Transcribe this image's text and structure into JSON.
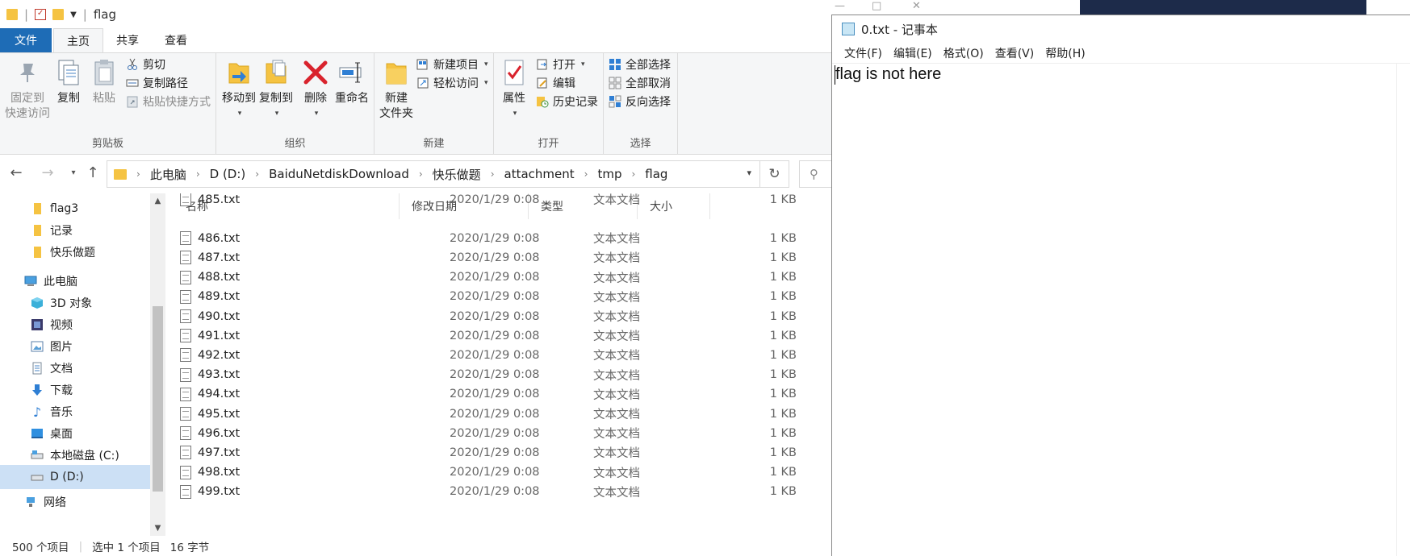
{
  "explorer": {
    "title": "flag",
    "tabs": [
      "文件",
      "主页",
      "共享",
      "查看"
    ],
    "ribbon": {
      "clipboard": {
        "label": "剪贴板",
        "pin": [
          "固定到",
          "快速访问"
        ],
        "copy": "复制",
        "paste": "粘贴",
        "cut": "剪切",
        "copy_path": "复制路径",
        "paste_shortcut": "粘贴快捷方式"
      },
      "organize": {
        "label": "组织",
        "move_to": "移动到",
        "copy_to": "复制到",
        "delete": "删除",
        "rename": "重命名"
      },
      "new": {
        "label": "新建",
        "new_folder": [
          "新建",
          "文件夹"
        ],
        "new_item": "新建项目",
        "easy_access": "轻松访问"
      },
      "open": {
        "label": "打开",
        "properties": "属性",
        "open": "打开",
        "edit": "编辑",
        "history": "历史记录"
      },
      "select": {
        "label": "选择",
        "select_all": "全部选择",
        "select_none": "全部取消",
        "invert": "反向选择"
      }
    },
    "breadcrumb": [
      "此电脑",
      "D (D:)",
      "BaiduNetdiskDownload",
      "快乐做题",
      "attachment",
      "tmp",
      "flag"
    ],
    "nav": [
      {
        "label": "flag3",
        "icon": "folder-icon"
      },
      {
        "label": "记录",
        "icon": "folder-icon"
      },
      {
        "label": "快乐做题",
        "icon": "folder-icon"
      },
      {
        "label": "此电脑",
        "icon": "computer-icon"
      },
      {
        "label": "3D 对象",
        "icon": "3d-objects-icon"
      },
      {
        "label": "视频",
        "icon": "video-icon"
      },
      {
        "label": "图片",
        "icon": "pictures-icon"
      },
      {
        "label": "文档",
        "icon": "documents-icon"
      },
      {
        "label": "下载",
        "icon": "download-icon"
      },
      {
        "label": "音乐",
        "icon": "music-icon"
      },
      {
        "label": "桌面",
        "icon": "desktop-icon"
      },
      {
        "label": "本地磁盘 (C:)",
        "icon": "drive-icon"
      },
      {
        "label": "D (D:)",
        "icon": "drive-icon"
      },
      {
        "label": "网络",
        "icon": "network-icon"
      }
    ],
    "columns": {
      "name": "名称",
      "date": "修改日期",
      "type": "类型",
      "size": "大小"
    },
    "files": [
      {
        "name": "485.txt",
        "date": "2020/1/29 0:08",
        "type": "文本文档",
        "size": "1 KB"
      },
      {
        "name": "486.txt",
        "date": "2020/1/29 0:08",
        "type": "文本文档",
        "size": "1 KB"
      },
      {
        "name": "487.txt",
        "date": "2020/1/29 0:08",
        "type": "文本文档",
        "size": "1 KB"
      },
      {
        "name": "488.txt",
        "date": "2020/1/29 0:08",
        "type": "文本文档",
        "size": "1 KB"
      },
      {
        "name": "489.txt",
        "date": "2020/1/29 0:08",
        "type": "文本文档",
        "size": "1 KB"
      },
      {
        "name": "490.txt",
        "date": "2020/1/29 0:08",
        "type": "文本文档",
        "size": "1 KB"
      },
      {
        "name": "491.txt",
        "date": "2020/1/29 0:08",
        "type": "文本文档",
        "size": "1 KB"
      },
      {
        "name": "492.txt",
        "date": "2020/1/29 0:08",
        "type": "文本文档",
        "size": "1 KB"
      },
      {
        "name": "493.txt",
        "date": "2020/1/29 0:08",
        "type": "文本文档",
        "size": "1 KB"
      },
      {
        "name": "494.txt",
        "date": "2020/1/29 0:08",
        "type": "文本文档",
        "size": "1 KB"
      },
      {
        "name": "495.txt",
        "date": "2020/1/29 0:08",
        "type": "文本文档",
        "size": "1 KB"
      },
      {
        "name": "496.txt",
        "date": "2020/1/29 0:08",
        "type": "文本文档",
        "size": "1 KB"
      },
      {
        "name": "497.txt",
        "date": "2020/1/29 0:08",
        "type": "文本文档",
        "size": "1 KB"
      },
      {
        "name": "498.txt",
        "date": "2020/1/29 0:08",
        "type": "文本文档",
        "size": "1 KB"
      },
      {
        "name": "499.txt",
        "date": "2020/1/29 0:08",
        "type": "文本文档",
        "size": "1 KB"
      }
    ],
    "status": {
      "count": "500 个项目",
      "selected": "选中 1 个项目",
      "size": "16 字节"
    }
  },
  "notepad": {
    "title": "0.txt - 记事本",
    "menu": [
      "文件(F)",
      "编辑(E)",
      "格式(O)",
      "查看(V)",
      "帮助(H)"
    ],
    "content": "flag is not here"
  },
  "colors": {
    "accent": "#1e6cb6",
    "selection": "#cce0f5",
    "folder": "#f5c342",
    "delete": "#d9232d"
  }
}
